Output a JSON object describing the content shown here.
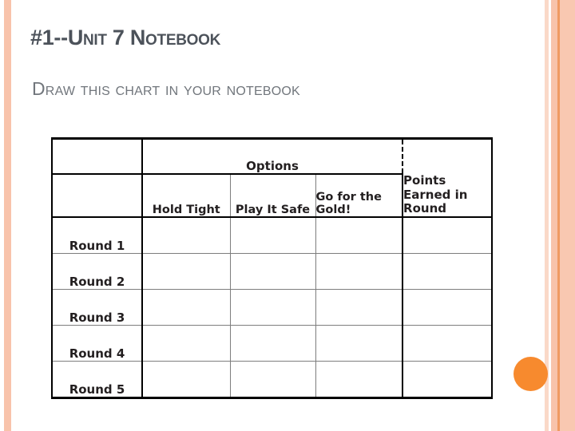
{
  "slide": {
    "title": "#1--Unit 7 Notebook",
    "subtitle": "Draw this chart in your notebook",
    "accent_color": "#f78a2e",
    "stripe_color": "#f8c3ab",
    "title_color": "#4c525a",
    "subtitle_color": "#71767c"
  },
  "chart_data": {
    "type": "table",
    "title": "",
    "group_header": "Options",
    "corner_header": "",
    "columns": [
      "",
      "Hold Tight",
      "Play It Safe",
      "Go for the Gold!",
      "Points Earned in Round"
    ],
    "option_columns": [
      "Hold Tight",
      "Play It Safe",
      "Go for the Gold!"
    ],
    "points_column": "Points Earned in Round",
    "rows": [
      {
        "label": "Round 1",
        "values": [
          "",
          "",
          "",
          ""
        ]
      },
      {
        "label": "Round 2",
        "values": [
          "",
          "",
          "",
          ""
        ]
      },
      {
        "label": "Round 3",
        "values": [
          "",
          "",
          "",
          ""
        ]
      },
      {
        "label": "Round 4",
        "values": [
          "",
          "",
          "",
          ""
        ]
      },
      {
        "label": "Round 5",
        "values": [
          "",
          "",
          "",
          ""
        ]
      }
    ],
    "row_labels": [
      "Round 1",
      "Round 2",
      "Round 3",
      "Round 4",
      "Round 5"
    ],
    "grid": true,
    "notes": "Empty worksheet grid for students to copy; all data cells are blank."
  }
}
